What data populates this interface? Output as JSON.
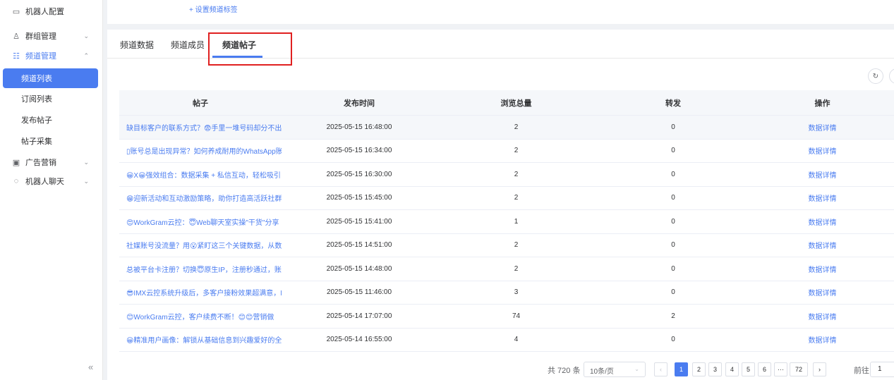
{
  "sidebar": {
    "items": [
      {
        "label": "机器人配置",
        "icon": "robot-icon"
      },
      {
        "label": "群组管理",
        "icon": "users-icon"
      },
      {
        "label": "频道管理",
        "icon": "channel-icon"
      },
      {
        "label": "频道列表"
      },
      {
        "label": "订阅列表"
      },
      {
        "label": "发布帖子"
      },
      {
        "label": "帖子采集"
      },
      {
        "label": "广告营销",
        "icon": "ad-icon"
      },
      {
        "label": "机器人聊天",
        "icon": "chat-icon"
      }
    ],
    "collapse": "«"
  },
  "topbar": {
    "tag_link": "+ 设置频道标签"
  },
  "tabs": [
    {
      "label": "频道数据"
    },
    {
      "label": "频道成员"
    },
    {
      "label": "频道帖子"
    }
  ],
  "table": {
    "headers": [
      "帖子",
      "发布时间",
      "浏览总量",
      "转发",
      "操作"
    ],
    "rows": [
      {
        "post": "缺目标客户的联系方式？😨手里一堆号码却分不出",
        "time": "2025-05-15 16:48:00",
        "views": "2",
        "forwards": "0",
        "action": "数据详情"
      },
      {
        "post": "▯账号总是出现异常？如何养成耐用的WhatsApp账",
        "time": "2025-05-15 16:34:00",
        "views": "2",
        "forwards": "0",
        "action": "数据详情"
      },
      {
        "post": "😀X😀强效组合：数据采集 + 私信互动，轻松吸引",
        "time": "2025-05-15 16:30:00",
        "views": "2",
        "forwards": "0",
        "action": "数据详情"
      },
      {
        "post": "😁迎新活动和互动激励策略，助你打造高活跃社群",
        "time": "2025-05-15 15:45:00",
        "views": "2",
        "forwards": "0",
        "action": "数据详情"
      },
      {
        "post": "😍WorkGram云控：😇Web聊天室实操\"干货\"分享",
        "time": "2025-05-15 15:41:00",
        "views": "1",
        "forwards": "0",
        "action": "数据详情"
      },
      {
        "post": "社媒账号没流量？用😮紧盯这三个关键数据，从数",
        "time": "2025-05-15 14:51:00",
        "views": "2",
        "forwards": "0",
        "action": "数据详情"
      },
      {
        "post": "总被平台卡注册？切换😇原生IP，注册秒通过，账",
        "time": "2025-05-15 14:48:00",
        "views": "2",
        "forwards": "0",
        "action": "数据详情"
      },
      {
        "post": "😎IMX云控系统升级后，多客户接粉效果超满意，I",
        "time": "2025-05-15 11:46:00",
        "views": "3",
        "forwards": "0",
        "action": "数据详情"
      },
      {
        "post": "😊WorkGram云控，客户续费不断！😊😊营销做",
        "time": "2025-05-14 17:07:00",
        "views": "74",
        "forwards": "2",
        "action": "数据详情"
      },
      {
        "post": "😀精准用户画像：解锁从基础信息到兴趣爱好的全",
        "time": "2025-05-14 16:55:00",
        "views": "4",
        "forwards": "0",
        "action": "数据详情"
      }
    ]
  },
  "pagination": {
    "total": "共 720 条",
    "page_size": "10条/页",
    "pages": [
      "1",
      "2",
      "3",
      "4",
      "5",
      "6",
      "···",
      "72"
    ],
    "prev": "‹",
    "next": "›",
    "goto_label": "前往",
    "goto_value": "1"
  },
  "colors": {
    "accent": "#4a7cf0",
    "highlight": "#e02020"
  }
}
